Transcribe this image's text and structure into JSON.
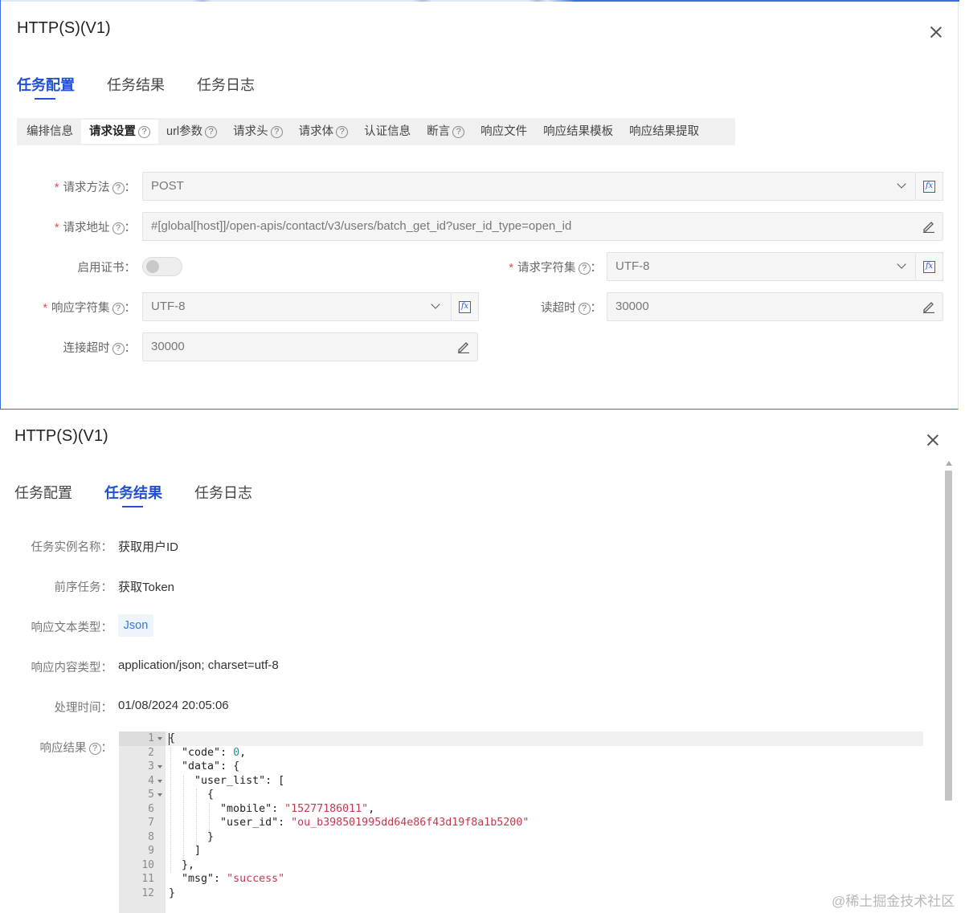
{
  "panel1": {
    "title": "HTTP(S)(V1)",
    "tabs": [
      "任务配置",
      "任务结果",
      "任务日志"
    ],
    "active_tab": "任务配置",
    "subtabs": [
      {
        "label": "编排信息",
        "help": false
      },
      {
        "label": "请求设置",
        "help": true
      },
      {
        "label": "url参数",
        "help": true
      },
      {
        "label": "请求头",
        "help": true
      },
      {
        "label": "请求体",
        "help": true
      },
      {
        "label": "认证信息",
        "help": false
      },
      {
        "label": "断言",
        "help": true
      },
      {
        "label": "响应文件",
        "help": false
      },
      {
        "label": "响应结果模板",
        "help": false
      },
      {
        "label": "响应结果提取",
        "help": false
      }
    ],
    "active_subtab": "请求设置",
    "help_glyph": "?",
    "colon": "：",
    "req_mark": "*",
    "fields": {
      "method": {
        "label": "请求方法",
        "value": "POST"
      },
      "url": {
        "label": "请求地址",
        "value": "#[global[host]]/open-apis/contact/v3/users/batch_get_id?user_id_type=open_id"
      },
      "cert": {
        "label": "启用证书",
        "enabled": false
      },
      "req_charset": {
        "label": "请求字符集",
        "value": "UTF-8"
      },
      "resp_charset": {
        "label": "响应字符集",
        "value": "UTF-8"
      },
      "read_timeout": {
        "label": "读超时",
        "value": "30000"
      },
      "conn_timeout": {
        "label": "连接超时",
        "value": "30000"
      }
    },
    "fx_glyph": "fx"
  },
  "panel2": {
    "title": "HTTP(S)(V1)",
    "tabs": [
      "任务配置",
      "任务结果",
      "任务日志"
    ],
    "active_tab": "任务结果",
    "rows": {
      "instance_name": {
        "label": "任务实例名称：",
        "value": "获取用户ID"
      },
      "prev_task": {
        "label": "前序任务：",
        "value": "获取Token"
      },
      "resp_text_type": {
        "label": "响应文本类型：",
        "value": "Json"
      },
      "resp_content_type": {
        "label": "响应内容类型：",
        "value": "application/json; charset=utf-8"
      },
      "process_time": {
        "label": "处理时间：",
        "value": "01/08/2024 20:05:06"
      },
      "resp_result": {
        "label": "响应结果"
      }
    },
    "code_lines": [
      "{",
      "  \"code\": 0,",
      "  \"data\": {",
      "    \"user_list\": [",
      "      {",
      "        \"mobile\": \"15277186011\",",
      "        \"user_id\": \"ou_b398501995dd64e86f43d19f8a1b5200\"",
      "      }",
      "    ]",
      "  },",
      "  \"msg\": \"success\"",
      "}"
    ],
    "line_numbers": [
      "1",
      "2",
      "3",
      "4",
      "5",
      "6",
      "7",
      "8",
      "9",
      "10",
      "11",
      "12"
    ]
  },
  "watermark": "@稀土掘金技术社区",
  "colors": {
    "accent": "#2150d0",
    "required": "#e34d4d",
    "string": "#c4384f",
    "number": "#2a8a8a"
  }
}
